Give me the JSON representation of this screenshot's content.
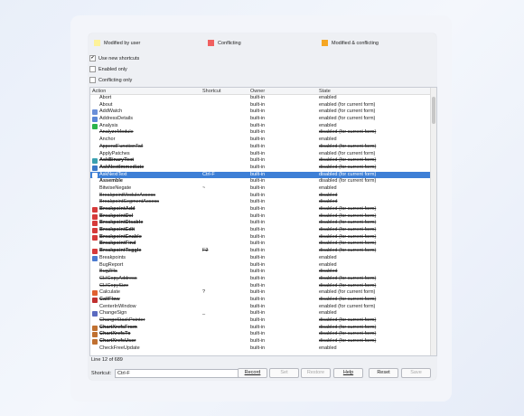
{
  "legend": [
    {
      "label": "Modified by user",
      "color": "#fdf29a"
    },
    {
      "label": "Conflicting",
      "color": "#f06060"
    },
    {
      "label": "Modified & conflicting",
      "color": "#f5a623"
    }
  ],
  "options": [
    {
      "label": "Use new shortcuts",
      "checked": "✔"
    },
    {
      "label": "Enabled only",
      "checked": ""
    },
    {
      "label": "Conflicting only",
      "checked": ""
    }
  ],
  "columns": [
    "Action",
    "Shortcut",
    "Owner",
    "State"
  ],
  "rows": [
    {
      "action": "Abort",
      "shortcut": "",
      "owner": "built-in",
      "state": "enabled",
      "strike": false,
      "bold": false
    },
    {
      "action": "About",
      "shortcut": "",
      "owner": "built-in",
      "state": "enabled (for current form)",
      "strike": false,
      "bold": false
    },
    {
      "action": "AddWatch",
      "shortcut": "",
      "owner": "built-in",
      "state": "enabled (for current form)",
      "strike": false,
      "bold": false,
      "icon": "#6a8fd8"
    },
    {
      "action": "AddressDetails",
      "shortcut": "",
      "owner": "built-in",
      "state": "enabled (for current form)",
      "strike": false,
      "bold": false,
      "icon": "#5a86d6"
    },
    {
      "action": "Analysis",
      "shortcut": "",
      "owner": "built-in",
      "state": "enabled",
      "strike": false,
      "bold": false,
      "icon": "#2bb34a"
    },
    {
      "action": "AnalyzeModule",
      "shortcut": "",
      "owner": "built-in",
      "state": "disabled (for current form)",
      "strike": true,
      "bold": false
    },
    {
      "action": "Anchor",
      "shortcut": "",
      "owner": "built-in",
      "state": "enabled",
      "strike": false,
      "bold": false
    },
    {
      "action": "AppendFunctionTail",
      "shortcut": "",
      "owner": "built-in",
      "state": "disabled (for current form)",
      "strike": true,
      "bold": false
    },
    {
      "action": "ApplyPatches",
      "shortcut": "",
      "owner": "built-in",
      "state": "enabled (for current form)",
      "strike": false,
      "bold": false
    },
    {
      "action": "AskBinaryText",
      "shortcut": "",
      "owner": "built-in",
      "state": "disabled (for current form)",
      "strike": true,
      "bold": true,
      "icon": "#3aa0b0"
    },
    {
      "action": "AskNextImmediate",
      "shortcut": "",
      "owner": "built-in",
      "state": "disabled (for current form)",
      "strike": true,
      "bold": true,
      "icon": "#3a78c8"
    },
    {
      "action": "AskNextText",
      "shortcut": "Ctrl-F",
      "owner": "built-in",
      "state": "disabled (for current form)",
      "strike": false,
      "bold": false,
      "selected": true,
      "icon": "#ffffff"
    },
    {
      "action": "Assemble",
      "shortcut": "",
      "owner": "built-in",
      "state": "disabled (for current form)",
      "strike": false,
      "bold": true
    },
    {
      "action": "BitwiseNegate",
      "shortcut": "~",
      "owner": "built-in",
      "state": "enabled",
      "strike": false,
      "bold": false
    },
    {
      "action": "BreakpointModuleAccess",
      "shortcut": "",
      "owner": "built-in",
      "state": "disabled",
      "strike": true,
      "bold": false
    },
    {
      "action": "BreakpointSegmentAccess",
      "shortcut": "",
      "owner": "built-in",
      "state": "disabled",
      "strike": true,
      "bold": false
    },
    {
      "action": "BreakpointAdd",
      "shortcut": "",
      "owner": "built-in",
      "state": "disabled (for current form)",
      "strike": true,
      "bold": true,
      "icon": "#d63a3a"
    },
    {
      "action": "BreakpointDel",
      "shortcut": "",
      "owner": "built-in",
      "state": "disabled (for current form)",
      "strike": true,
      "bold": true,
      "icon": "#d63a3a"
    },
    {
      "action": "BreakpointDisable",
      "shortcut": "",
      "owner": "built-in",
      "state": "disabled (for current form)",
      "strike": true,
      "bold": true,
      "icon": "#d63a3a"
    },
    {
      "action": "BreakpointEdit",
      "shortcut": "",
      "owner": "built-in",
      "state": "disabled (for current form)",
      "strike": true,
      "bold": true,
      "icon": "#d63a3a"
    },
    {
      "action": "BreakpointEnable",
      "shortcut": "",
      "owner": "built-in",
      "state": "disabled (for current form)",
      "strike": true,
      "bold": true,
      "icon": "#d63a3a"
    },
    {
      "action": "BreakpointFind",
      "shortcut": "",
      "owner": "built-in",
      "state": "disabled (for current form)",
      "strike": true,
      "bold": true
    },
    {
      "action": "BreakpointToggle",
      "shortcut": "F2",
      "owner": "built-in",
      "state": "disabled (for current form)",
      "strike": true,
      "bold": true,
      "icon": "#d63a3a"
    },
    {
      "action": "Breakpoints",
      "shortcut": "",
      "owner": "built-in",
      "state": "enabled",
      "strike": false,
      "bold": false,
      "icon": "#4a7ad0"
    },
    {
      "action": "BugReport",
      "shortcut": "",
      "owner": "built-in",
      "state": "enabled",
      "strike": false,
      "bold": false
    },
    {
      "action": "BugZilla",
      "shortcut": "",
      "owner": "built-in",
      "state": "disabled",
      "strike": true,
      "bold": false
    },
    {
      "action": "CLICopyAddress",
      "shortcut": "",
      "owner": "built-in",
      "state": "disabled (for current form)",
      "strike": true,
      "bold": false
    },
    {
      "action": "CLICopySize",
      "shortcut": "",
      "owner": "built-in",
      "state": "disabled (for current form)",
      "strike": true,
      "bold": false
    },
    {
      "action": "Calculate",
      "shortcut": "?",
      "owner": "built-in",
      "state": "enabled (for current form)",
      "strike": false,
      "bold": false,
      "icon": "#e06030"
    },
    {
      "action": "CallFlow",
      "shortcut": "",
      "owner": "built-in",
      "state": "disabled (for current form)",
      "strike": true,
      "bold": true,
      "icon": "#c03030"
    },
    {
      "action": "CenterInWindow",
      "shortcut": "",
      "owner": "built-in",
      "state": "enabled (for current form)",
      "strike": false,
      "bold": false
    },
    {
      "action": "ChangeSign",
      "shortcut": "_",
      "owner": "built-in",
      "state": "enabled",
      "strike": false,
      "bold": false,
      "icon": "#5a6ac0"
    },
    {
      "action": "ChangeStackPointer",
      "shortcut": "",
      "owner": "built-in",
      "state": "disabled (for current form)",
      "strike": true,
      "bold": false
    },
    {
      "action": "ChartXrefsFrom",
      "shortcut": "",
      "owner": "built-in",
      "state": "disabled (for current form)",
      "strike": true,
      "bold": true,
      "icon": "#c07030"
    },
    {
      "action": "ChartXrefsTo",
      "shortcut": "",
      "owner": "built-in",
      "state": "disabled (for current form)",
      "strike": true,
      "bold": true,
      "icon": "#c07030"
    },
    {
      "action": "ChartXrefsUser",
      "shortcut": "",
      "owner": "built-in",
      "state": "disabled (for current form)",
      "strike": true,
      "bold": true,
      "icon": "#c07030"
    },
    {
      "action": "CheckFreeUpdate",
      "shortcut": "",
      "owner": "built-in",
      "state": "enabled",
      "strike": false,
      "bold": false
    }
  ],
  "footer": {
    "line_info": "Line 12 of 689"
  },
  "shortcut": {
    "label": "Shortcut:",
    "value": "Ctrl-F"
  },
  "buttons": [
    {
      "label": "Record",
      "disabled": false,
      "underline": true
    },
    {
      "label": "Set",
      "disabled": true
    },
    {
      "label": "Restore",
      "disabled": true
    },
    {
      "label": "Help",
      "disabled": false,
      "underline": true
    },
    {
      "label": "Reset",
      "disabled": false
    },
    {
      "label": "Save",
      "disabled": true
    }
  ]
}
